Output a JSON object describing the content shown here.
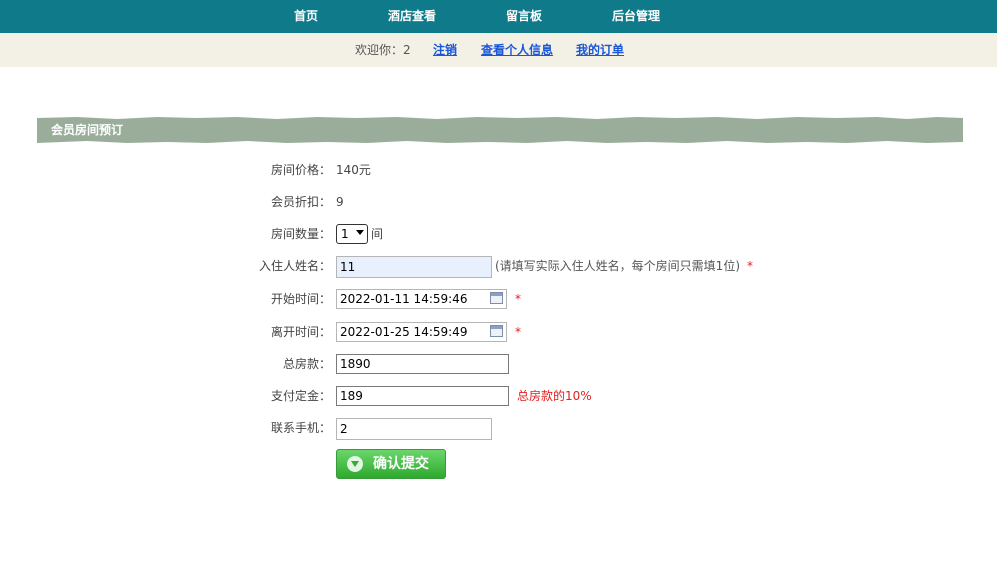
{
  "nav": {
    "items": [
      "首页",
      "酒店查看",
      "留言板",
      "后台管理"
    ]
  },
  "subnav": {
    "welcome": "欢迎你：2",
    "logout": "注销",
    "profile": "查看个人信息",
    "orders": "我的订单"
  },
  "section": {
    "title": "会员房间预订"
  },
  "form": {
    "price_label": "房间价格：",
    "price_value": "140元",
    "discount_label": "会员折扣：",
    "discount_value": "9",
    "room_count_label": "房间数量：",
    "room_count_value": "1",
    "room_count_unit": "间",
    "guest_label": "入住人姓名：",
    "guest_value": "11",
    "guest_hint": "(请填写实际入住人姓名，每个房间只需填1位)",
    "start_label": "开始时间：",
    "start_value": "2022-01-11 14:59:46",
    "end_label": "离开时间：",
    "end_value": "2022-01-25 14:59:49",
    "total_label": "总房款：",
    "total_value": "1890",
    "deposit_label": "支付定金：",
    "deposit_value": "189",
    "deposit_hint": "总房款的10%",
    "phone_label": "联系手机：",
    "phone_value": "2",
    "required_mark": "*",
    "submit_label": "确认提交"
  },
  "colors": {
    "nav_bg": "#0e7a8a",
    "subnav_bg": "#f3f1e6",
    "banner_bg": "#9aad9b",
    "link": "#1a56d6",
    "required": "#e02020",
    "submit": "#2ea92e"
  }
}
